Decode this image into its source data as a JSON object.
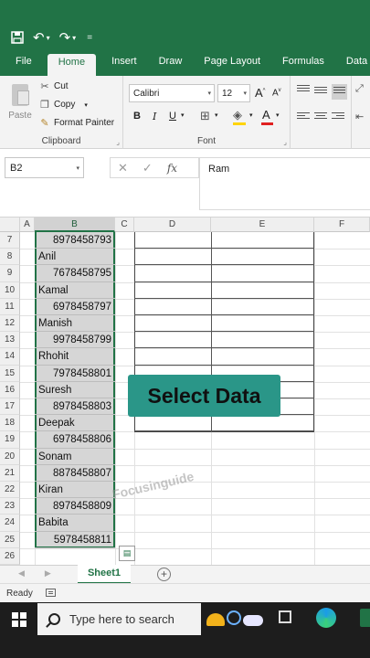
{
  "quick_access": {
    "save_icon": "save-icon",
    "undo_icon": "undo-icon",
    "redo_icon": "redo-icon",
    "customize": "="
  },
  "tabs": [
    {
      "label": "File",
      "active": false
    },
    {
      "label": "Home",
      "active": true
    },
    {
      "label": "Insert",
      "active": false
    },
    {
      "label": "Draw",
      "active": false
    },
    {
      "label": "Page Layout",
      "active": false
    },
    {
      "label": "Formulas",
      "active": false
    },
    {
      "label": "Data",
      "active": false
    }
  ],
  "ribbon": {
    "clipboard": {
      "label": "Clipboard",
      "paste": "Paste",
      "cut": "Cut",
      "copy": "Copy",
      "format_painter": "Format Painter"
    },
    "font": {
      "label": "Font",
      "font_name": "Calibri",
      "font_size": "12",
      "bold": "B",
      "italic": "I",
      "underline": "U",
      "grow": "A",
      "shrink": "A"
    }
  },
  "formula_bar": {
    "name_box": "B2",
    "cancel": "✕",
    "enter": "✓",
    "fx": "fx",
    "value": "Ram"
  },
  "grid": {
    "columns": [
      "A",
      "B",
      "C",
      "D",
      "E",
      "F"
    ],
    "selected_column": "B",
    "rows": [
      {
        "row": "7",
        "b": "8978458793",
        "num": true
      },
      {
        "row": "8",
        "b": "Anil",
        "num": false
      },
      {
        "row": "9",
        "b": "7678458795",
        "num": true
      },
      {
        "row": "10",
        "b": "Kamal",
        "num": false
      },
      {
        "row": "11",
        "b": "6978458797",
        "num": true
      },
      {
        "row": "12",
        "b": "Manish",
        "num": false
      },
      {
        "row": "13",
        "b": "9978458799",
        "num": true
      },
      {
        "row": "14",
        "b": "Rhohit",
        "num": false
      },
      {
        "row": "15",
        "b": "7978458801",
        "num": true
      },
      {
        "row": "16",
        "b": "Suresh",
        "num": false
      },
      {
        "row": "17",
        "b": "8978458803",
        "num": true
      },
      {
        "row": "18",
        "b": "Deepak",
        "num": false
      },
      {
        "row": "19",
        "b": "6978458806",
        "num": true
      },
      {
        "row": "20",
        "b": "Sonam",
        "num": false
      },
      {
        "row": "21",
        "b": "8878458807",
        "num": true
      },
      {
        "row": "22",
        "b": "Kiran",
        "num": false
      },
      {
        "row": "23",
        "b": "8978458809",
        "num": true
      },
      {
        "row": "24",
        "b": "Babita",
        "num": false
      },
      {
        "row": "25",
        "b": "5978458811",
        "num": true
      },
      {
        "row": "26",
        "b": "",
        "num": false
      }
    ]
  },
  "overlay": {
    "caption": "Select Data",
    "watermark": "Focusinguide"
  },
  "sheets": {
    "active": "Sheet1",
    "add": "+"
  },
  "status": {
    "text": "Ready"
  },
  "taskbar": {
    "search_placeholder": "Type here to search"
  },
  "colors": {
    "excel_green": "#217346",
    "overlay_teal": "#2a9688"
  }
}
